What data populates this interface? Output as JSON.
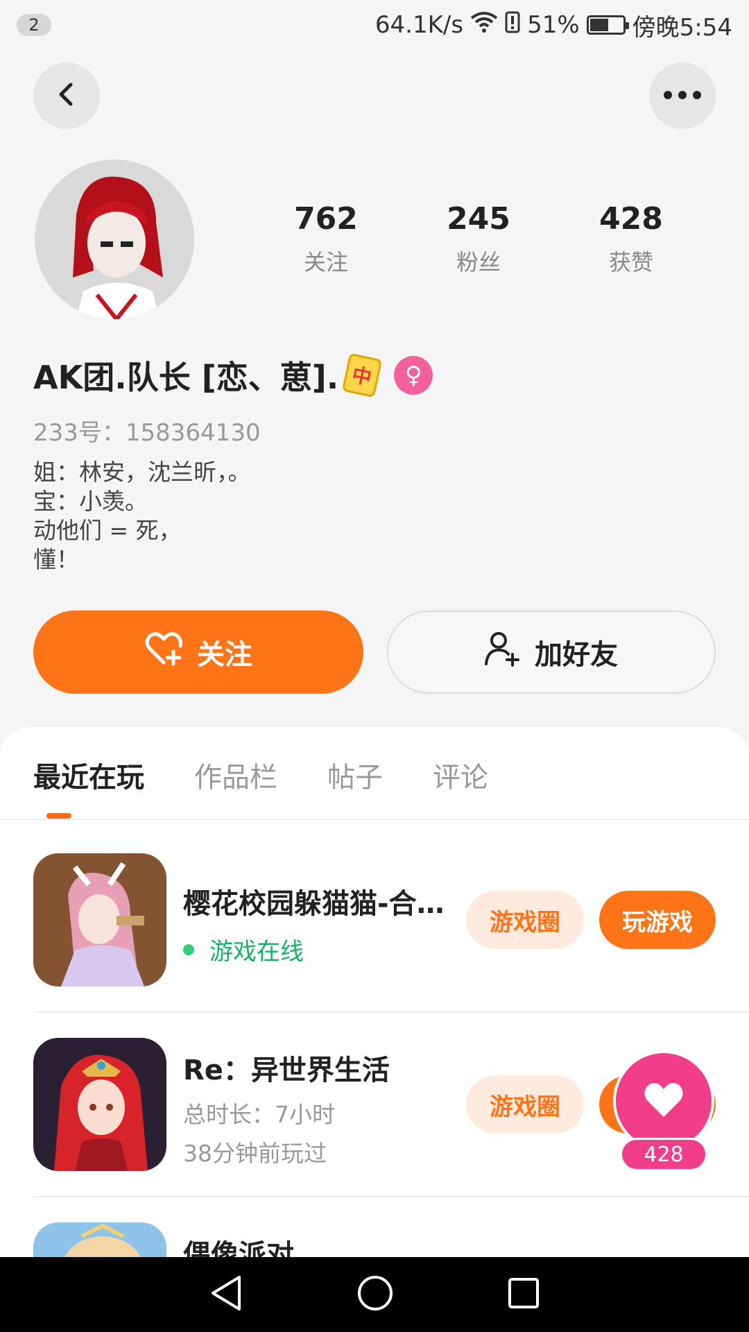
{
  "status_bar": {
    "notification_count": "2",
    "network_speed": "64.1K/s",
    "battery_percent": "51%",
    "time": "傍晚5:54"
  },
  "profile": {
    "stats": [
      {
        "value": "762",
        "label": "关注"
      },
      {
        "value": "245",
        "label": "粉丝"
      },
      {
        "value": "428",
        "label": "获赞"
      }
    ],
    "username": "AK团.队长 [恋、葸].",
    "mahjong_glyph": "中",
    "uid": "233号：158364130",
    "bio_lines": [
      "姐：林安，沈兰昕，。",
      "宝：小羡。",
      "动他们 = 死，",
      "懂！"
    ]
  },
  "actions": {
    "follow_label": "关注",
    "add_friend_label": "加好友"
  },
  "tabs": [
    {
      "label": "最近在玩",
      "active": true
    },
    {
      "label": "作品栏",
      "active": false
    },
    {
      "label": "帖子",
      "active": false
    },
    {
      "label": "评论",
      "active": false
    }
  ],
  "games": [
    {
      "title": "樱花校园躲猫猫-合…",
      "status": "游戏在线",
      "circle_label": "游戏圈",
      "play_label": "玩游戏"
    },
    {
      "title": "Re：异世界生活",
      "duration": "总时长：7小时",
      "last_played": "38分钟前玩过",
      "circle_label": "游戏圈"
    },
    {
      "title": "偶像派对"
    }
  ],
  "floating_like": {
    "count": "428"
  },
  "colors": {
    "accent": "#ff7417",
    "like": "#f23e8a",
    "online": "#17b26a"
  },
  "icons": [
    "back-icon",
    "more-icon",
    "heart-plus-icon",
    "add-user-icon",
    "heart-icon",
    "nav-back-icon",
    "nav-home-icon",
    "nav-recents-icon"
  ]
}
